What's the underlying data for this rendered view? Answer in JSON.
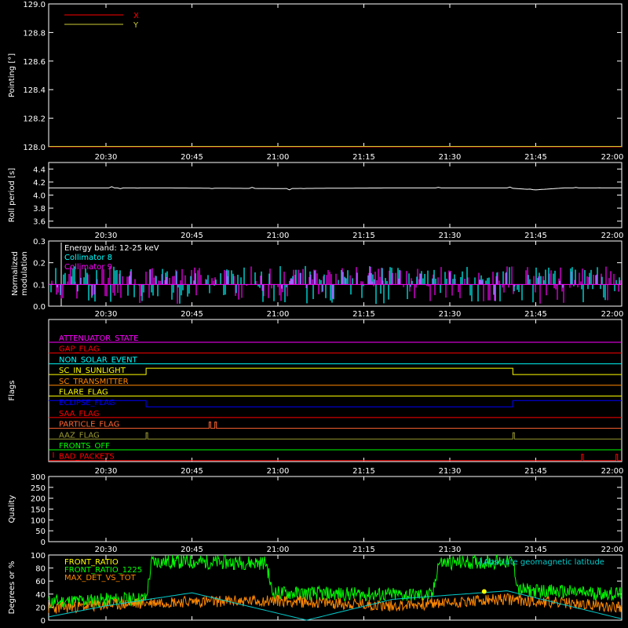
{
  "colors": {
    "background": "#000000",
    "frame": "#ffffff",
    "x_series": "#ff0000",
    "y_series": "#cccc33",
    "roll": "#ffffff",
    "collimator8": "#00ffff",
    "collimator9": "#ff00ff",
    "front_ratio": "#ffff00",
    "front_ratio_1225": "#00ff00",
    "max_det": "#ff8800",
    "geo_lat": "#00cccc"
  },
  "time_axis": {
    "range": [
      "20:20",
      "22:00"
    ],
    "ticks": [
      "20:30",
      "20:45",
      "21:00",
      "21:15",
      "21:30",
      "21:45",
      "22:00"
    ]
  },
  "chart_data": [
    {
      "id": "pointing",
      "type": "line",
      "ylabel": "Pointing [°]",
      "ylim": [
        128.0,
        129.0
      ],
      "yticks": [
        "129.0",
        "128.8",
        "128.6",
        "128.4",
        "128.2",
        "128.0"
      ],
      "ytick_values": [
        129.0,
        128.8,
        128.6,
        128.4,
        128.2,
        128.0
      ],
      "legend": [
        "X",
        "Y"
      ],
      "series": [
        {
          "name": "X",
          "x": [
            "20:20",
            "22:00"
          ],
          "values": [
            128.0,
            128.0
          ]
        },
        {
          "name": "Y",
          "x": [
            "20:20",
            "22:00"
          ],
          "values": [
            128.0,
            128.0
          ]
        }
      ]
    },
    {
      "id": "roll",
      "type": "line",
      "ylabel": "Roll period [s]",
      "ylim": [
        3.5,
        4.5
      ],
      "yticks": [
        "4.4",
        "4.2",
        "4.0",
        "3.8",
        "3.6"
      ],
      "ytick_values": [
        4.4,
        4.2,
        4.0,
        3.8,
        3.6
      ],
      "series": [
        {
          "x": [
            "20:20",
            "20:40",
            "21:00",
            "21:20",
            "21:40",
            "21:45",
            "21:50",
            "22:00"
          ],
          "values": [
            4.11,
            4.11,
            4.1,
            4.11,
            4.11,
            4.08,
            4.11,
            4.11
          ]
        }
      ]
    },
    {
      "id": "modulation",
      "type": "bar",
      "ylabel": "Normalized modulation",
      "ylim": [
        0.0,
        0.3
      ],
      "yticks": [
        "0.3",
        "0.2",
        "0.1",
        "0.0"
      ],
      "ytick_values": [
        0.3,
        0.2,
        0.1,
        0.0
      ],
      "annotation": "Energy band: 12-25 keV",
      "baseline": 0.1,
      "series": [
        {
          "name": "Collimator 8",
          "x": [
            "20:20",
            "20:40",
            "21:00",
            "21:20",
            "21:40",
            "22:00"
          ],
          "values": [
            0.15,
            0.12,
            0.11,
            0.12,
            0.13,
            0.12
          ]
        },
        {
          "name": "Collimator 9",
          "x": [
            "20:20",
            "20:40",
            "21:00",
            "21:20",
            "21:40",
            "22:00"
          ],
          "values": [
            0.14,
            0.12,
            0.11,
            0.12,
            0.12,
            0.12
          ]
        }
      ]
    },
    {
      "id": "flags",
      "type": "line",
      "ylabel": "Flags",
      "rows": [
        {
          "name": "ATTENUATOR_STATE",
          "color": "#ff00ff",
          "pulses": []
        },
        {
          "name": "GAP_FLAG",
          "color": "#ff0000",
          "pulses": []
        },
        {
          "name": "NON_SOLAR_EVENT",
          "color": "#00ffff",
          "pulses": []
        },
        {
          "name": "SC_IN_SUNLIGHT",
          "color": "#ffff00",
          "pulses": [
            [
              "20:37",
              "21:41"
            ]
          ]
        },
        {
          "name": "SC_TRANSMITTER",
          "color": "#ff8800",
          "pulses": []
        },
        {
          "name": "FLARE_FLAG",
          "color": "#ffff00",
          "pulses": []
        },
        {
          "name": "ECLIPSE_FLAG",
          "color": "#0000ff",
          "pulses": [
            [
              "20:20",
              "20:37"
            ],
            [
              "21:41",
              "22:00"
            ]
          ]
        },
        {
          "name": "SAA_FLAG",
          "color": "#ff0000",
          "pulses": []
        },
        {
          "name": "PARTICLE_FLAG",
          "color": "#ff6633",
          "pulses": [
            [
              "20:48",
              "20:48"
            ],
            [
              "20:49",
              "20:49"
            ]
          ]
        },
        {
          "name": "AAZ_FLAG",
          "color": "#999933",
          "pulses": [
            [
              "20:37",
              "20:37"
            ],
            [
              "21:41",
              "21:41"
            ]
          ]
        },
        {
          "name": "FRONTS_OFF",
          "color": "#00ff00",
          "pulses": []
        },
        {
          "name": "BAD_PACKETS",
          "color": "#ff0000",
          "pulses": [
            [
              "21:53",
              "21:53"
            ],
            [
              "21:59",
              "21:59"
            ]
          ]
        }
      ]
    },
    {
      "id": "quality",
      "type": "line",
      "ylabel": "Quality",
      "ylim": [
        0,
        300
      ],
      "yticks": [
        "300",
        "250",
        "200",
        "150",
        "100",
        "50",
        "0"
      ],
      "ytick_values": [
        300,
        250,
        200,
        150,
        100,
        50,
        0
      ],
      "series": []
    },
    {
      "id": "ratios",
      "type": "line",
      "ylabel": "Degrees or %",
      "ylim": [
        0,
        100
      ],
      "yticks": [
        "100",
        "80",
        "60",
        "40",
        "20",
        "0"
      ],
      "ytick_values": [
        100,
        80,
        60,
        40,
        20,
        0
      ],
      "legend_left": [
        "FRONT_RATIO",
        "FRONT_RATIO_1225",
        "MAX_DET_VS_TOT"
      ],
      "legend_right": "Absolute geomagnetic latitude",
      "series": [
        {
          "name": "FRONT_RATIO_1225",
          "x": [
            "20:20",
            "20:37",
            "20:38",
            "20:58",
            "20:59",
            "21:27",
            "21:28",
            "21:41",
            "21:42",
            "22:00"
          ],
          "values": [
            28,
            33,
            90,
            88,
            42,
            38,
            88,
            90,
            46,
            40
          ]
        },
        {
          "name": "MAX_DET_VS_TOT",
          "x": [
            "20:20",
            "20:40",
            "21:00",
            "21:20",
            "21:40",
            "22:00"
          ],
          "values": [
            18,
            28,
            30,
            22,
            32,
            20
          ]
        },
        {
          "name": "Absolute geomagnetic latitude",
          "x": [
            "20:20",
            "20:30",
            "20:45",
            "21:05",
            "21:20",
            "21:40",
            "22:00"
          ],
          "values": [
            5,
            22,
            42,
            0,
            32,
            45,
            2
          ]
        },
        {
          "name": "FRONT_RATIO",
          "x": [
            "21:36"
          ],
          "values": [
            44
          ]
        }
      ]
    }
  ]
}
